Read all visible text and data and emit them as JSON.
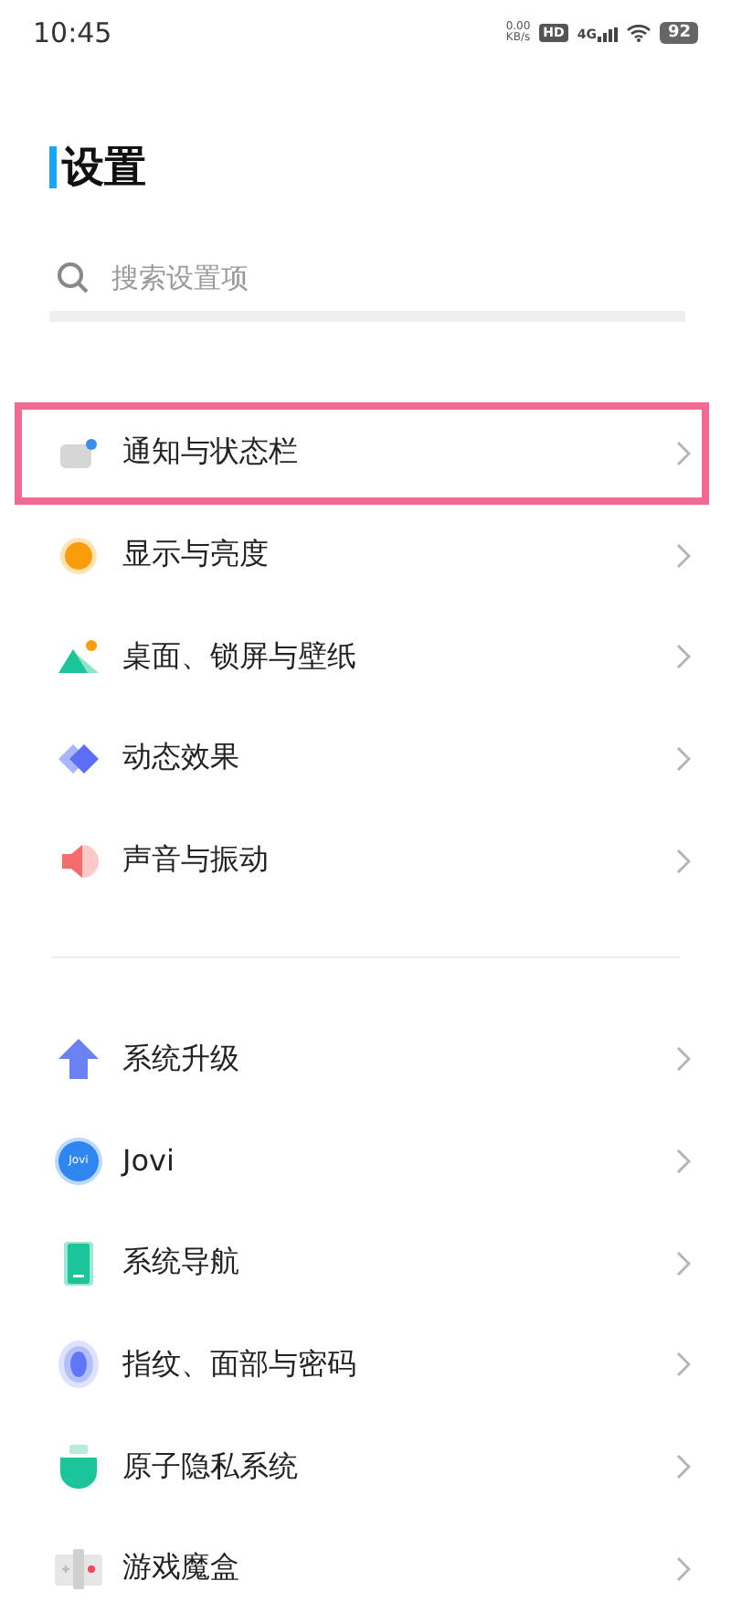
{
  "status_bar": {
    "time": "10:45",
    "net_speed": "0.00",
    "net_unit": "KB/s",
    "hd": "HD",
    "network": "4G",
    "battery": "92"
  },
  "title": "设置",
  "search": {
    "placeholder": "搜索设置项"
  },
  "groups": [
    {
      "items": [
        {
          "label": "通知与状态栏",
          "highlighted": true
        },
        {
          "label": "显示与亮度",
          "highlighted": false
        },
        {
          "label": "桌面、锁屏与壁纸",
          "highlighted": false
        },
        {
          "label": "动态效果",
          "highlighted": false
        },
        {
          "label": "声音与振动",
          "highlighted": false
        }
      ]
    },
    {
      "items": [
        {
          "label": "系统升级",
          "highlighted": false
        },
        {
          "label": "Jovi",
          "icon_text": "Jovi",
          "highlighted": false
        },
        {
          "label": "系统导航",
          "highlighted": false
        },
        {
          "label": "指纹、面部与密码",
          "highlighted": false
        },
        {
          "label": "原子隐私系统",
          "highlighted": false
        },
        {
          "label": "游戏魔盒",
          "highlighted": false
        }
      ]
    }
  ]
}
